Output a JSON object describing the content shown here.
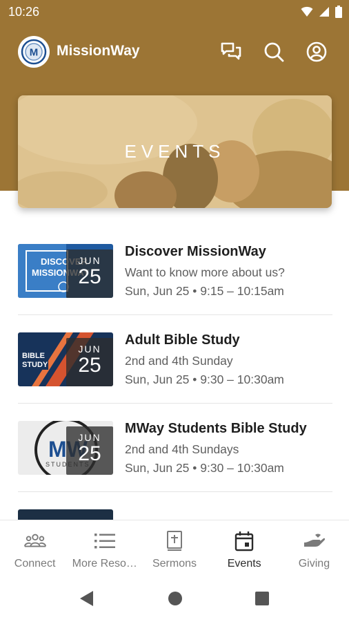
{
  "status_bar": {
    "time": "10:26"
  },
  "app_bar": {
    "title": "MissionWay",
    "logo_letter": "M"
  },
  "hero": {
    "title": "EVENTS"
  },
  "events": [
    {
      "title": "Discover MissionWay",
      "subtitle": "Want to know more about us?",
      "datetime": "Sun, Jun 25 • 9:15 – 10:15am",
      "month": "JUN",
      "day": "25",
      "thumb_text": "DISCOVER MISSIONWAY"
    },
    {
      "title": "Adult Bible Study",
      "subtitle": "2nd and 4th Sunday",
      "datetime": "Sun, Jun 25 • 9:30 – 10:30am",
      "month": "JUN",
      "day": "25",
      "thumb_text": "BIBLE STUDY"
    },
    {
      "title": "MWay Students Bible Study",
      "subtitle": "2nd and 4th Sundays",
      "datetime": "Sun, Jun 25 • 9:30 – 10:30am",
      "month": "JUN",
      "day": "25",
      "thumb_text": "MW STUDENTS"
    }
  ],
  "bottom_nav": [
    {
      "label": "Connect",
      "icon": "people-icon"
    },
    {
      "label": "More Reso…",
      "icon": "list-icon"
    },
    {
      "label": "Sermons",
      "icon": "bible-icon"
    },
    {
      "label": "Events",
      "icon": "calendar-icon",
      "active": true
    },
    {
      "label": "Giving",
      "icon": "giving-hand-icon"
    }
  ],
  "colors": {
    "brand": "#9c7535",
    "hero_tint": "#d6aa58",
    "logo_blue": "#1d4f91"
  }
}
